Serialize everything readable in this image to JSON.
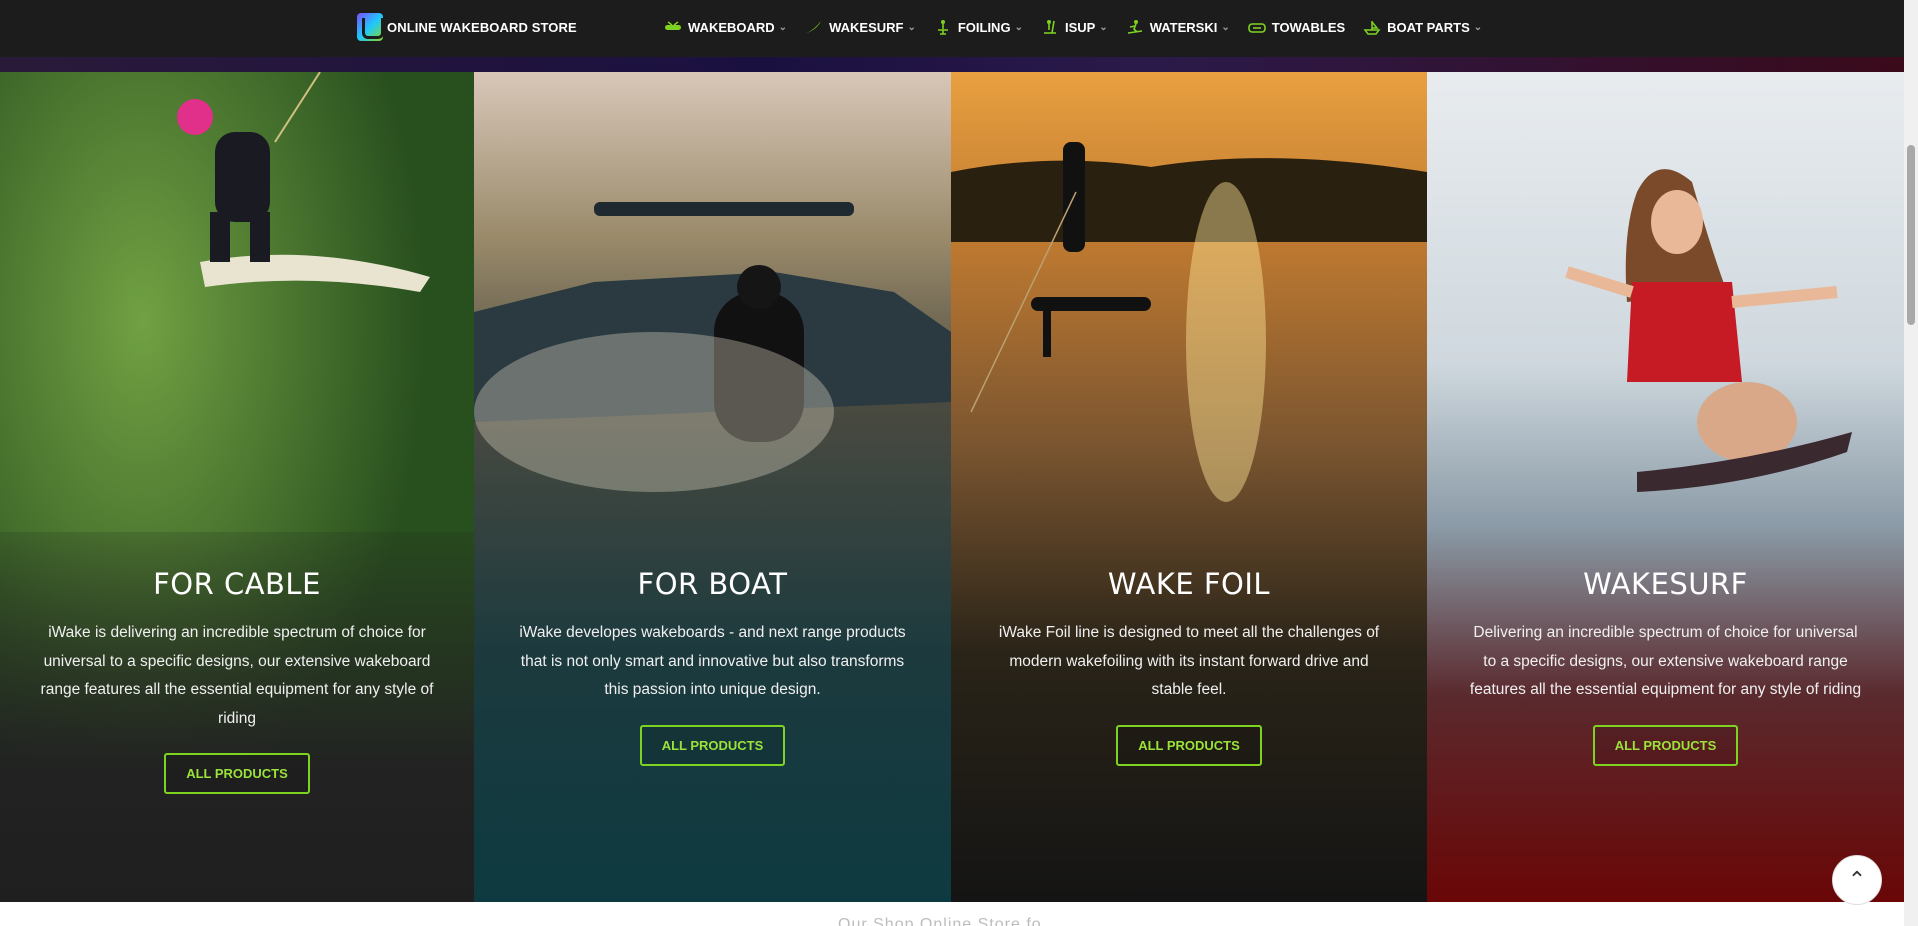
{
  "header": {
    "logo_text": "ONLINE WAKEBOARD STORE",
    "nav": [
      {
        "label": "WAKEBOARD",
        "icon": "wakeboard-icon",
        "has_dropdown": true
      },
      {
        "label": "WAKESURF",
        "icon": "wakesurf-icon",
        "has_dropdown": true
      },
      {
        "label": "FOILING",
        "icon": "foiling-icon",
        "has_dropdown": true
      },
      {
        "label": "ISUP",
        "icon": "isup-icon",
        "has_dropdown": true
      },
      {
        "label": "WATERSKI",
        "icon": "waterski-icon",
        "has_dropdown": true
      },
      {
        "label": "TOWABLES",
        "icon": "towables-icon",
        "has_dropdown": false
      },
      {
        "label": "BOAT PARTS",
        "icon": "boat-parts-icon",
        "has_dropdown": true
      }
    ]
  },
  "panels": [
    {
      "title": "FOR CABLE",
      "description": "iWake is delivering an incredible spectrum of choice for universal to a specific designs, our extensive wakeboard range features  all the essential equipment for any style of riding",
      "button": "ALL PRODUCTS"
    },
    {
      "title": "FOR BOAT",
      "description": "iWake developes wakeboards - and next range products that is not only smart and innovative but also transforms this passion into unique design.",
      "button": "ALL PRODUCTS"
    },
    {
      "title": "WAKE FOIL",
      "description": "iWake Foil line is designed to meet all the challenges of modern wakefoiling with its instant forward drive and stable feel.",
      "button": "ALL PRODUCTS"
    },
    {
      "title": "WAKESURF",
      "description": "Delivering an incredible spectrum of choice for universal to a specific designs, our extensive wakeboard range features  all the essential equipment for any style of riding",
      "button": "ALL PRODUCTS"
    }
  ],
  "bottom_text": "Our Shop Online Store fo",
  "colors": {
    "accent": "#7ed321",
    "header_bg": "#1c1c1c"
  },
  "scroll_top_icon": "chevron-up-icon"
}
